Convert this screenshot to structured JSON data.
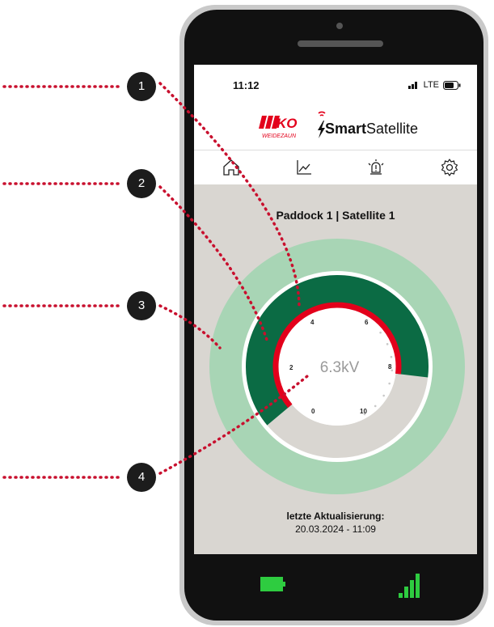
{
  "status_bar": {
    "time": "11:12",
    "network": "LTE"
  },
  "brand": {
    "ako_logo": "AKO",
    "ako_sub": "WEIDEZAUN",
    "product_bold": "Smart",
    "product_rest": "Satellite"
  },
  "nav": [
    {
      "icon": "home-icon"
    },
    {
      "icon": "chart-icon"
    },
    {
      "icon": "alarm-icon"
    },
    {
      "icon": "gear-icon"
    }
  ],
  "device_title": "Paddock 1 | Satellite 1",
  "gauge": {
    "value_label": "6.3kV",
    "value": 6.3,
    "scale_max": 10,
    "tick_labels": [
      "0",
      "2",
      "4",
      "6",
      "8",
      "10"
    ],
    "colors": {
      "outer_ring": "#a8d5b5",
      "dark_fill": "#0b6b44",
      "grey_fill": "#d9d6d1",
      "indicator": "#e3001b"
    }
  },
  "last_update": {
    "label": "letzte Aktualisierung:",
    "value": "20.03.2024 - 11:09"
  },
  "callouts": [
    "1",
    "2",
    "3",
    "4"
  ],
  "bottom_bar": {
    "battery_icon": "battery-icon",
    "signal_icon": "signal-icon"
  }
}
